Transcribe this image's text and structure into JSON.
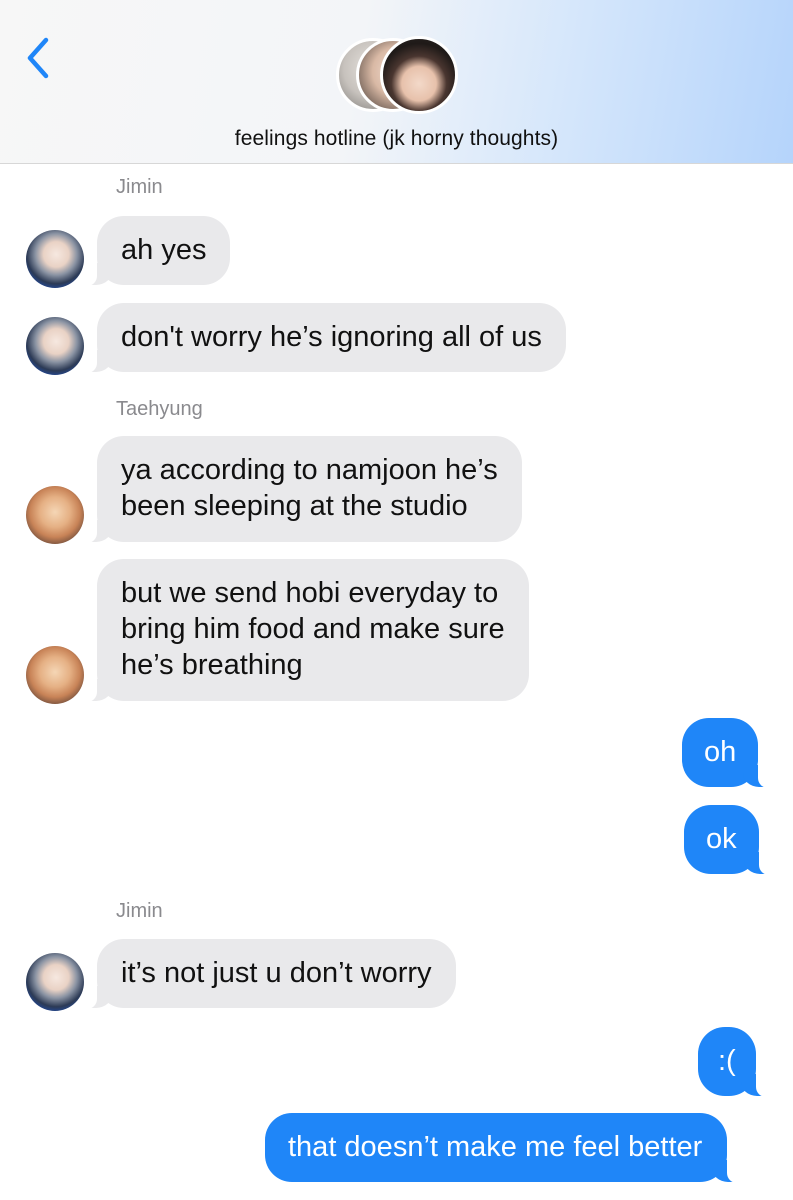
{
  "header": {
    "title": "feelings hotline (jk horny thoughts)",
    "back_icon": "chevron-left-icon",
    "accent_color": "#1f86f8"
  },
  "messages": [
    {
      "type": "sender",
      "text": "Jimin"
    },
    {
      "type": "incoming",
      "sender": "Jimin",
      "lines": [
        "ah yes"
      ]
    },
    {
      "type": "incoming",
      "sender": "Jimin",
      "lines": [
        "don't worry he’s ignoring all of us"
      ]
    },
    {
      "type": "sender",
      "text": "Taehyung"
    },
    {
      "type": "incoming",
      "sender": "Taehyung",
      "lines": [
        "ya according to namjoon he’s",
        "been sleeping at the studio"
      ]
    },
    {
      "type": "incoming",
      "sender": "Taehyung",
      "lines": [
        "but we send hobi everyday to",
        "bring him food and make sure",
        "he’s breathing"
      ]
    },
    {
      "type": "outgoing",
      "lines": [
        "oh"
      ]
    },
    {
      "type": "outgoing",
      "lines": [
        "ok"
      ]
    },
    {
      "type": "sender",
      "text": "Jimin"
    },
    {
      "type": "incoming",
      "sender": "Jimin",
      "lines": [
        "it’s not just u don’t worry"
      ]
    },
    {
      "type": "outgoing",
      "lines": [
        ":("
      ]
    },
    {
      "type": "outgoing",
      "lines": [
        "that doesn’t make me feel better"
      ]
    }
  ],
  "colors": {
    "incoming_bubble": "#e9e9eb",
    "outgoing_bubble": "#1f86f8",
    "sender_name": "#8a8a8e"
  }
}
